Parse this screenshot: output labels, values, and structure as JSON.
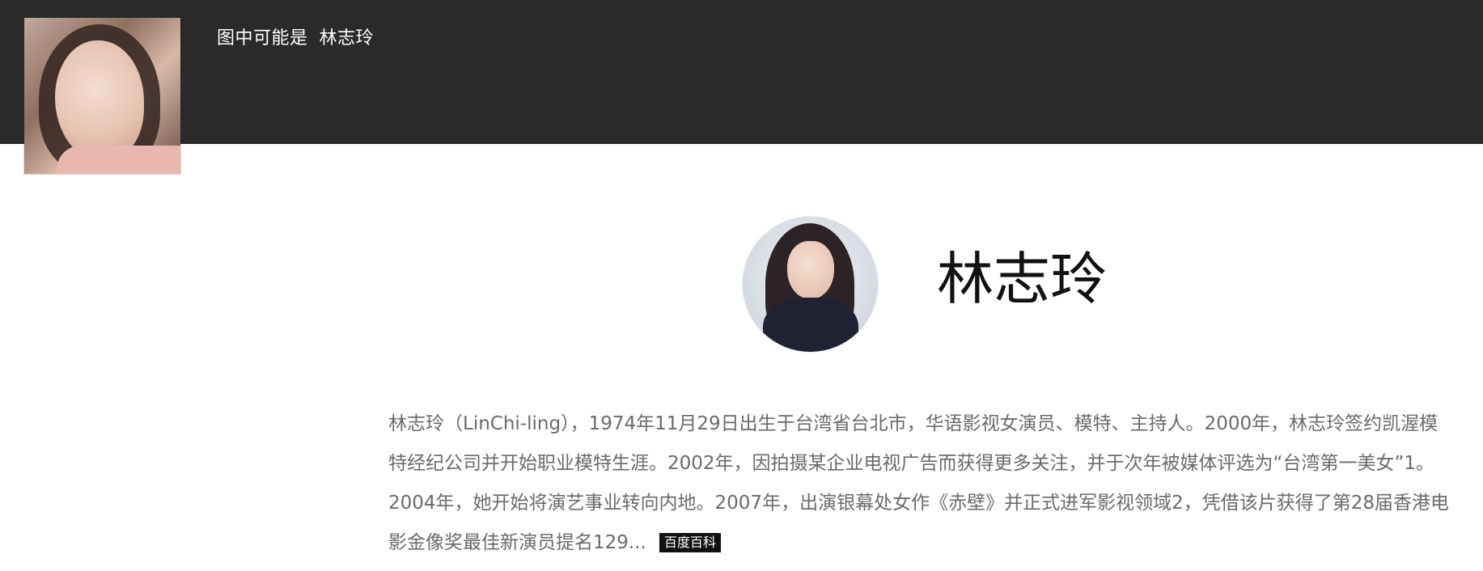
{
  "topbar": {
    "prefix": "图中可能是",
    "name": "林志玲"
  },
  "entity": {
    "title": "林志玲",
    "description": "林志玲（LinChi-ling），1974年11月29日出生于台湾省台北市，华语影视女演员、模特、主持人。2000年，林志玲签约凯渥模特经纪公司并开始职业模特生涯。2002年，因拍摄某企业电视广告而获得更多关注，并于次年被媒体评选为“台湾第一美女”1。2004年，她开始将演艺事业转向内地。2007年，出演银幕处女作《赤壁》并正式进军影视领域2，凭借该片获得了第28届香港电影金像奖最佳新演员提名129...",
    "source_badge": "百度百科"
  }
}
